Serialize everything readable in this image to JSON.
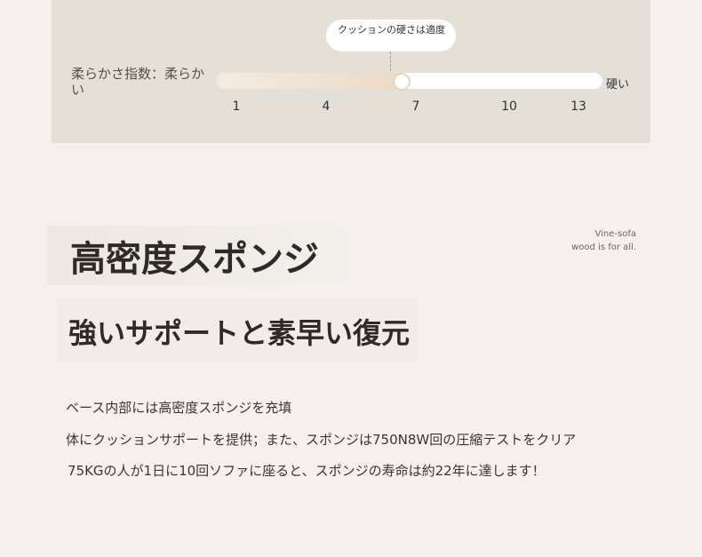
{
  "softness": {
    "label": "柔らかさ指数：柔らかい",
    "tooltip": "クッションの硬さは適度",
    "end_label": "硬い",
    "ticks": [
      "1",
      "4",
      "7",
      "10",
      "13"
    ],
    "level": 6.5
  },
  "brand": {
    "line1": "Vine-sofa",
    "line2": "wood is for all."
  },
  "heading": {
    "title": "高密度スポンジ",
    "subtitle": "強いサポートと素早い復元"
  },
  "description": [
    "ベース内部には高密度スポンジを充填",
    "体にクッションサポートを提供；また、スポンジは750N8W回の圧縮テストをクリア",
    "75KGの人が1日に10回ソファに座ると、スポンジの寿命は約22年に達します！"
  ]
}
